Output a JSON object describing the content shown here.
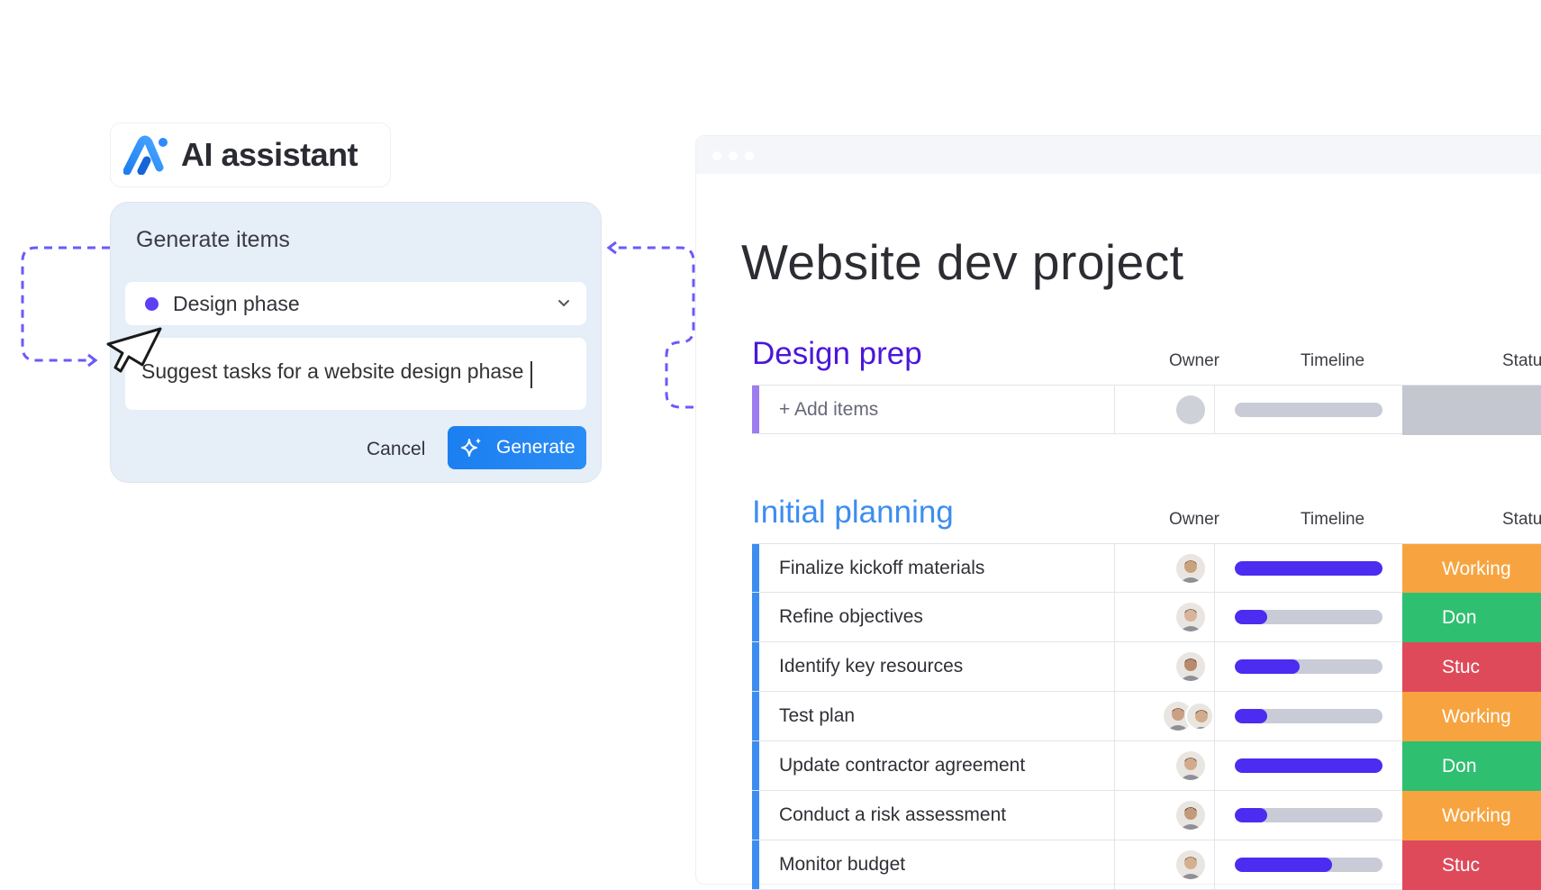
{
  "ai_badge": {
    "title": "AI assistant"
  },
  "dialog": {
    "title": "Generate items",
    "selected_group": "Design phase",
    "group_color": "#5b3ff5",
    "prompt_value": "Suggest tasks for a website design phase",
    "cancel_label": "Cancel",
    "generate_label": "Generate"
  },
  "board": {
    "title": "Website dev project",
    "groups": [
      {
        "title": "Design prep",
        "color": "#4a17d9",
        "columns": [
          "Owner",
          "Timeline",
          "Statu"
        ],
        "add_label": "+ Add items"
      },
      {
        "title": "Initial planning",
        "color": "#3c8df0",
        "columns": [
          "Owner",
          "Timeline",
          "Statu"
        ],
        "rows": [
          {
            "name": "Finalize kickoff materials",
            "progress": 1.0,
            "status": "Working",
            "status_color": "#f7a440"
          },
          {
            "name": "Refine objectives",
            "progress": 0.22,
            "status": "Don",
            "status_color": "#2fbf71"
          },
          {
            "name": "Identify key resources",
            "progress": 0.44,
            "status": "Stuc",
            "status_color": "#df4a5a"
          },
          {
            "name": "Test plan",
            "progress": 0.22,
            "status": "Working",
            "status_color": "#f7a440"
          },
          {
            "name": "Update contractor agreement",
            "progress": 1.0,
            "status": "Don",
            "status_color": "#2fbf71"
          },
          {
            "name": "Conduct a risk assessment",
            "progress": 0.22,
            "status": "Working",
            "status_color": "#f7a440"
          },
          {
            "name": "Monitor budget",
            "progress": 0.66,
            "status": "Stuc",
            "status_color": "#df4a5a"
          }
        ]
      }
    ]
  }
}
